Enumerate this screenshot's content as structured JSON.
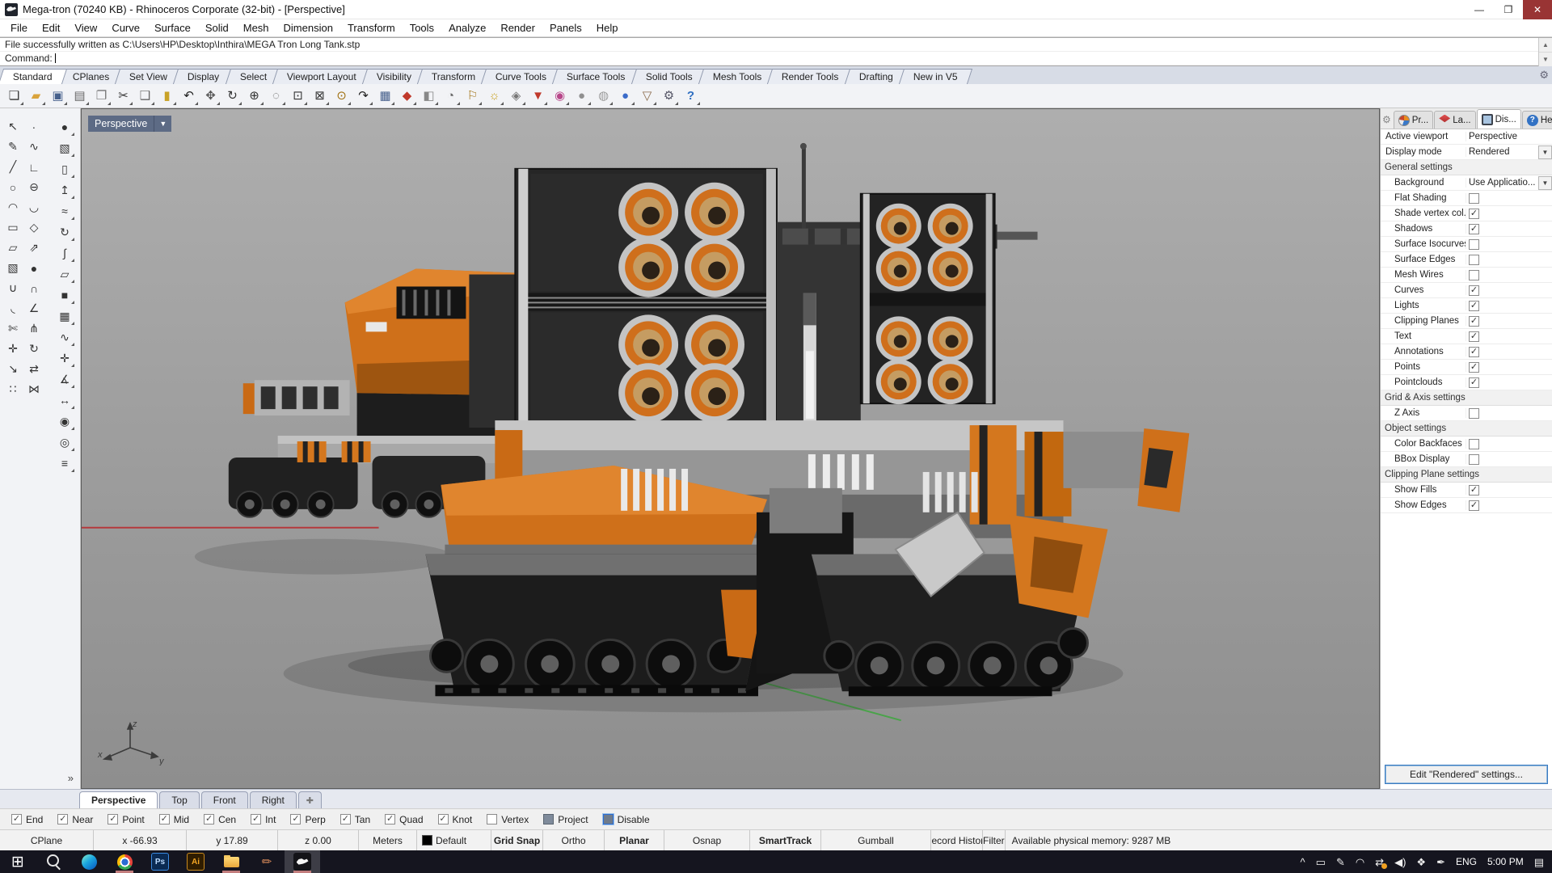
{
  "window": {
    "title": "Mega-tron (70240 KB) - Rhinoceros Corporate (32-bit) - [Perspective]",
    "controls": [
      {
        "name": "minimize-button",
        "glyph": "—"
      },
      {
        "name": "maximize-button",
        "glyph": "❐"
      },
      {
        "name": "close-button",
        "glyph": "✕"
      }
    ]
  },
  "menu": {
    "items": [
      {
        "name": "menu-file",
        "label": "File"
      },
      {
        "name": "menu-edit",
        "label": "Edit"
      },
      {
        "name": "menu-view",
        "label": "View"
      },
      {
        "name": "menu-curve",
        "label": "Curve"
      },
      {
        "name": "menu-surface",
        "label": "Surface"
      },
      {
        "name": "menu-solid",
        "label": "Solid"
      },
      {
        "name": "menu-mesh",
        "label": "Mesh"
      },
      {
        "name": "menu-dimension",
        "label": "Dimension"
      },
      {
        "name": "menu-transform",
        "label": "Transform"
      },
      {
        "name": "menu-tools",
        "label": "Tools"
      },
      {
        "name": "menu-analyze",
        "label": "Analyze"
      },
      {
        "name": "menu-render",
        "label": "Render"
      },
      {
        "name": "menu-panels",
        "label": "Panels"
      },
      {
        "name": "menu-help",
        "label": "Help"
      }
    ]
  },
  "command": {
    "history": "File successfully written as C:\\Users\\HP\\Desktop\\Inthira\\MEGA Tron Long Tank.stp",
    "prompt": "Command:"
  },
  "toolbar_tabs": {
    "items": [
      {
        "name": "tab-standard",
        "label": "Standard",
        "active": true
      },
      {
        "name": "tab-cplanes",
        "label": "CPlanes"
      },
      {
        "name": "tab-set-view",
        "label": "Set View"
      },
      {
        "name": "tab-display",
        "label": "Display"
      },
      {
        "name": "tab-select",
        "label": "Select"
      },
      {
        "name": "tab-viewport-layout",
        "label": "Viewport Layout"
      },
      {
        "name": "tab-visibility",
        "label": "Visibility"
      },
      {
        "name": "tab-transform",
        "label": "Transform"
      },
      {
        "name": "tab-curve-tools",
        "label": "Curve Tools"
      },
      {
        "name": "tab-surface-tools",
        "label": "Surface Tools"
      },
      {
        "name": "tab-solid-tools",
        "label": "Solid Tools"
      },
      {
        "name": "tab-mesh-tools",
        "label": "Mesh Tools"
      },
      {
        "name": "tab-render-tools",
        "label": "Render Tools"
      },
      {
        "name": "tab-drafting",
        "label": "Drafting"
      },
      {
        "name": "tab-new-in-v5",
        "label": "New in V5"
      }
    ]
  },
  "toolbar": {
    "buttons": [
      {
        "name": "new-file-icon",
        "glyph": "❏",
        "style": "color:#333"
      },
      {
        "name": "open-file-icon",
        "glyph": "▰",
        "style": "color:#d9a33c"
      },
      {
        "name": "save-icon",
        "glyph": "▣",
        "style": "color:#46608c"
      },
      {
        "name": "print-icon",
        "glyph": "▤",
        "style": "color:#666"
      },
      {
        "name": "export-icon",
        "glyph": "❐",
        "style": "color:#777"
      },
      {
        "name": "cut-icon",
        "glyph": "✂",
        "style": "color:#333"
      },
      {
        "name": "copy-icon",
        "glyph": "❑",
        "style": "color:#666"
      },
      {
        "name": "paste-icon",
        "glyph": "▮",
        "style": "color:#c9a227"
      },
      {
        "name": "undo-icon",
        "glyph": "↶",
        "style": "color:#222"
      },
      {
        "name": "pan-icon",
        "glyph": "✥",
        "style": "color:#555"
      },
      {
        "name": "rotate-view-icon",
        "glyph": "↻",
        "style": "color:#333"
      },
      {
        "name": "zoom-in-icon",
        "glyph": "⊕",
        "style": "color:#333"
      },
      {
        "name": "zoom-dynamic-icon",
        "glyph": "◌",
        "style": "color:#555"
      },
      {
        "name": "zoom-window-icon",
        "glyph": "⊡",
        "style": "color:#333"
      },
      {
        "name": "zoom-extents-icon",
        "glyph": "⊠",
        "style": "color:#333"
      },
      {
        "name": "zoom-selected-icon",
        "glyph": "⊙",
        "style": "color:#a07010"
      },
      {
        "name": "undo-view-icon",
        "glyph": "↷",
        "style": "color:#222"
      },
      {
        "name": "viewport-layout-icon",
        "glyph": "▦",
        "style": "color:#46608c"
      },
      {
        "name": "render-icon",
        "glyph": "◆",
        "style": "color:#c0392b"
      },
      {
        "name": "render-region-icon",
        "glyph": "◧",
        "style": "color:#888"
      },
      {
        "name": "set-view-icon",
        "glyph": "◔",
        "style": "color:#666"
      },
      {
        "name": "annotate-icon",
        "glyph": "⚐",
        "style": "color:#a07010"
      },
      {
        "name": "light-icon",
        "glyph": "☼",
        "style": "color:#c8a020"
      },
      {
        "name": "lock-icon",
        "glyph": "◈",
        "style": "color:#777"
      },
      {
        "name": "layers-icon",
        "glyph": "▼",
        "style": "color:#c0392b"
      },
      {
        "name": "color-picker-icon",
        "glyph": "◉",
        "style": "color:#b8478a"
      },
      {
        "name": "shaded-display-icon",
        "glyph": "●",
        "style": "color:#909090"
      },
      {
        "name": "ghosted-display-icon",
        "glyph": "◍",
        "style": "color:#9a9a9a"
      },
      {
        "name": "rendered-display-icon",
        "glyph": "●",
        "style": "color:#3a6bc9"
      },
      {
        "name": "filter-icon",
        "glyph": "▽",
        "style": "color:#8a6a4a"
      },
      {
        "name": "options-gear-icon",
        "glyph": "⚙",
        "style": "color:#556"
      },
      {
        "name": "help-icon",
        "glyph": "?",
        "style": "color:#2f6fc1;font-weight:bold"
      }
    ]
  },
  "sidebar": {
    "colA": [
      {
        "name": "select-pointer-icon",
        "glyph": "↖"
      },
      {
        "name": "point-icon",
        "glyph": "∙"
      },
      {
        "name": "curve-pen-icon",
        "glyph": "✎"
      },
      {
        "name": "freeform-curve-icon",
        "glyph": "∿"
      },
      {
        "name": "line-icon",
        "glyph": "╱"
      },
      {
        "name": "polyline-icon",
        "glyph": "∟"
      },
      {
        "name": "circle-icon",
        "glyph": "○"
      },
      {
        "name": "ellipse-icon",
        "glyph": "⊖"
      },
      {
        "name": "arc-icon",
        "glyph": "◠"
      },
      {
        "name": "blend-curve-icon",
        "glyph": "◡"
      },
      {
        "name": "rectangle-icon",
        "glyph": "▭"
      },
      {
        "name": "polygon-icon",
        "glyph": "◇"
      },
      {
        "name": "surface-plane-icon",
        "glyph": "▱"
      },
      {
        "name": "extrude-icon",
        "glyph": "⇗"
      },
      {
        "name": "box-icon",
        "glyph": "▧"
      },
      {
        "name": "sphere-icon",
        "glyph": "●"
      },
      {
        "name": "boolean-union-icon",
        "glyph": "∪"
      },
      {
        "name": "boolean-intersect-icon",
        "glyph": "∩"
      },
      {
        "name": "fillet-icon",
        "glyph": "◟"
      },
      {
        "name": "chamfer-icon",
        "glyph": "∠"
      },
      {
        "name": "trim-icon",
        "glyph": "✄"
      },
      {
        "name": "split-icon",
        "glyph": "⋔"
      },
      {
        "name": "move-icon",
        "glyph": "✛"
      },
      {
        "name": "rotate-icon",
        "glyph": "↻"
      },
      {
        "name": "scale-icon",
        "glyph": "↘"
      },
      {
        "name": "mirror-icon",
        "glyph": "⇄"
      },
      {
        "name": "array-icon",
        "glyph": "∷"
      },
      {
        "name": "join-icon",
        "glyph": "⋈"
      }
    ],
    "colB": [
      {
        "name": "sphere-flyout-icon",
        "glyph": "●"
      },
      {
        "name": "box-flyout-icon",
        "glyph": "▧"
      },
      {
        "name": "cylinder-flyout-icon",
        "glyph": "▯"
      },
      {
        "name": "extrude-flyout-icon",
        "glyph": "↥"
      },
      {
        "name": "loft-flyout-icon",
        "glyph": "≈"
      },
      {
        "name": "revolve-flyout-icon",
        "glyph": "↻"
      },
      {
        "name": "sweep-flyout-icon",
        "glyph": "∫"
      },
      {
        "name": "surface-tools-icon",
        "glyph": "▱"
      },
      {
        "name": "solid-tools-icon",
        "glyph": "■"
      },
      {
        "name": "mesh-tools-icon",
        "glyph": "▦"
      },
      {
        "name": "curve-tools-icon",
        "glyph": "∿"
      },
      {
        "name": "transform-tools-icon",
        "glyph": "✛"
      },
      {
        "name": "analyze-tools-icon",
        "glyph": "∡"
      },
      {
        "name": "dimension-tools-icon",
        "glyph": "↔"
      },
      {
        "name": "render-tools-icon",
        "glyph": "◉"
      },
      {
        "name": "visibility-tools-icon",
        "glyph": "◎"
      },
      {
        "name": "layer-tools-icon",
        "glyph": "≡"
      }
    ],
    "more_label": "»"
  },
  "viewport": {
    "label": "Perspective",
    "axis": {
      "x": "x",
      "y": "y",
      "z": "z"
    },
    "axis_x_color": "#b5393c",
    "axis_y_color": "#4aa34a"
  },
  "panel": {
    "tabs": [
      {
        "name": "panel-tab-properties",
        "label": "Pr...",
        "icon": "properties"
      },
      {
        "name": "panel-tab-layers",
        "label": "La...",
        "icon": "layers"
      },
      {
        "name": "panel-tab-display",
        "label": "Dis...",
        "icon": "display",
        "active": true
      },
      {
        "name": "panel-tab-help",
        "label": "Help",
        "icon": "help"
      }
    ],
    "rows": [
      {
        "label": "Active viewport",
        "value": "Perspective",
        "type": "kv"
      },
      {
        "label": "Display mode",
        "value": "Rendered",
        "type": "drop"
      },
      {
        "label": "General settings",
        "type": "section"
      },
      {
        "label": "Background",
        "value": "Use Applicatio...",
        "type": "drop",
        "indent": true
      },
      {
        "label": "Flat Shading",
        "type": "check",
        "checked": false,
        "indent": true
      },
      {
        "label": "Shade vertex col...",
        "type": "check",
        "checked": true,
        "indent": true
      },
      {
        "label": "Shadows",
        "type": "check",
        "checked": true,
        "indent": true
      },
      {
        "label": "Surface Isocurves",
        "type": "check",
        "checked": false,
        "indent": true
      },
      {
        "label": "Surface Edges",
        "type": "check",
        "checked": false,
        "indent": true
      },
      {
        "label": "Mesh Wires",
        "type": "check",
        "checked": false,
        "indent": true
      },
      {
        "label": "Curves",
        "type": "check",
        "checked": true,
        "indent": true
      },
      {
        "label": "Lights",
        "type": "check",
        "checked": true,
        "indent": true
      },
      {
        "label": "Clipping Planes",
        "type": "check",
        "checked": true,
        "indent": true
      },
      {
        "label": "Text",
        "type": "check",
        "checked": true,
        "indent": true
      },
      {
        "label": "Annotations",
        "type": "check",
        "checked": true,
        "indent": true
      },
      {
        "label": "Points",
        "type": "check",
        "checked": true,
        "indent": true
      },
      {
        "label": "Pointclouds",
        "type": "check",
        "checked": true,
        "indent": true
      },
      {
        "label": "Grid & Axis settings",
        "type": "section"
      },
      {
        "label": "Z Axis",
        "type": "check",
        "checked": false,
        "indent": true
      },
      {
        "label": "Object settings",
        "type": "section"
      },
      {
        "label": "Color Backfaces",
        "type": "check",
        "checked": false,
        "indent": true
      },
      {
        "label": "BBox Display",
        "type": "check",
        "checked": false,
        "indent": true
      },
      {
        "label": "Clipping Plane settings",
        "type": "section"
      },
      {
        "label": "Show Fills",
        "type": "check",
        "checked": true,
        "indent": true
      },
      {
        "label": "Show Edges",
        "type": "check",
        "checked": true,
        "indent": true
      }
    ],
    "edit_button": "Edit \"Rendered\" settings..."
  },
  "viewport_tabs": {
    "items": [
      {
        "name": "vtab-perspective",
        "label": "Perspective",
        "active": true
      },
      {
        "name": "vtab-top",
        "label": "Top"
      },
      {
        "name": "vtab-front",
        "label": "Front"
      },
      {
        "name": "vtab-right",
        "label": "Right"
      },
      {
        "name": "vtab-add",
        "label": "✚",
        "add": true
      }
    ]
  },
  "osnap": {
    "items": [
      {
        "name": "osnap-end",
        "label": "End",
        "state": "checked"
      },
      {
        "name": "osnap-near",
        "label": "Near",
        "state": "checked"
      },
      {
        "name": "osnap-point",
        "label": "Point",
        "state": "checked"
      },
      {
        "name": "osnap-mid",
        "label": "Mid",
        "state": "checked"
      },
      {
        "name": "osnap-cen",
        "label": "Cen",
        "state": "checked"
      },
      {
        "name": "osnap-int",
        "label": "Int",
        "state": "checked"
      },
      {
        "name": "osnap-perp",
        "label": "Perp",
        "state": "checked"
      },
      {
        "name": "osnap-tan",
        "label": "Tan",
        "state": "checked"
      },
      {
        "name": "osnap-quad",
        "label": "Quad",
        "state": "checked"
      },
      {
        "name": "osnap-knot",
        "label": "Knot",
        "state": "checked"
      },
      {
        "name": "osnap-vertex",
        "label": "Vertex",
        "state": "unchecked"
      },
      {
        "name": "osnap-project",
        "label": "Project",
        "state": "filled"
      },
      {
        "name": "osnap-disable",
        "label": "Disable",
        "state": "filled-focus"
      }
    ]
  },
  "statusbar": {
    "layer_color": "#000000",
    "cells": [
      {
        "name": "cplane-cell",
        "text": "CPlane"
      },
      {
        "name": "x-coordinate",
        "text": "x -66.93"
      },
      {
        "name": "y-coordinate",
        "text": "y 17.89"
      },
      {
        "name": "z-coordinate",
        "text": "z 0.00"
      },
      {
        "name": "units-cell",
        "text": "Meters"
      },
      {
        "name": "layer-cell",
        "text": "Default",
        "swatch": true
      },
      {
        "name": "grid-snap-toggle",
        "text": "Grid Snap",
        "bold": true
      },
      {
        "name": "ortho-toggle",
        "text": "Ortho"
      },
      {
        "name": "planar-toggle",
        "text": "Planar",
        "bold": true
      },
      {
        "name": "osnap-toggle",
        "text": "Osnap"
      },
      {
        "name": "smarttrack-toggle",
        "text": "SmartTrack",
        "bold": true
      },
      {
        "name": "gumball-toggle",
        "text": "Gumball"
      },
      {
        "name": "record-history-toggle",
        "text": "Record History"
      },
      {
        "name": "filter-toggle",
        "text": "Filter"
      },
      {
        "name": "memory-status",
        "text": "Available physical memory: 9287 MB",
        "grow": true
      }
    ]
  },
  "taskbar": {
    "apps": [
      {
        "name": "start-button",
        "kind": "start"
      },
      {
        "name": "search-button",
        "kind": "search"
      },
      {
        "name": "edge-app",
        "kind": "edge"
      },
      {
        "name": "chrome-app",
        "kind": "chrome",
        "running": true
      },
      {
        "name": "photoshop-app",
        "kind": "ps",
        "label": "Ps"
      },
      {
        "name": "illustrator-app",
        "kind": "ai",
        "label": "Ai"
      },
      {
        "name": "explorer-app",
        "kind": "explorer",
        "running": true
      },
      {
        "name": "pencil-app",
        "kind": "pencil"
      },
      {
        "name": "rhino-app",
        "kind": "rhino",
        "running": true,
        "active": true
      }
    ],
    "tray": [
      {
        "name": "tray-expand-icon",
        "glyph": "^"
      },
      {
        "name": "cast-icon",
        "glyph": "▭"
      },
      {
        "name": "pen-settings-icon",
        "glyph": "✎"
      },
      {
        "name": "wifi-icon",
        "glyph": "◠"
      },
      {
        "name": "remote-access-icon",
        "glyph": "⇄",
        "dot": true
      },
      {
        "name": "volume-icon",
        "glyph": "◀)"
      },
      {
        "name": "dropbox-icon",
        "glyph": "❖"
      },
      {
        "name": "stylus-icon",
        "glyph": "✒"
      }
    ],
    "language": "ENG",
    "time": "5:00 PM",
    "action_center_glyph": "▤"
  }
}
